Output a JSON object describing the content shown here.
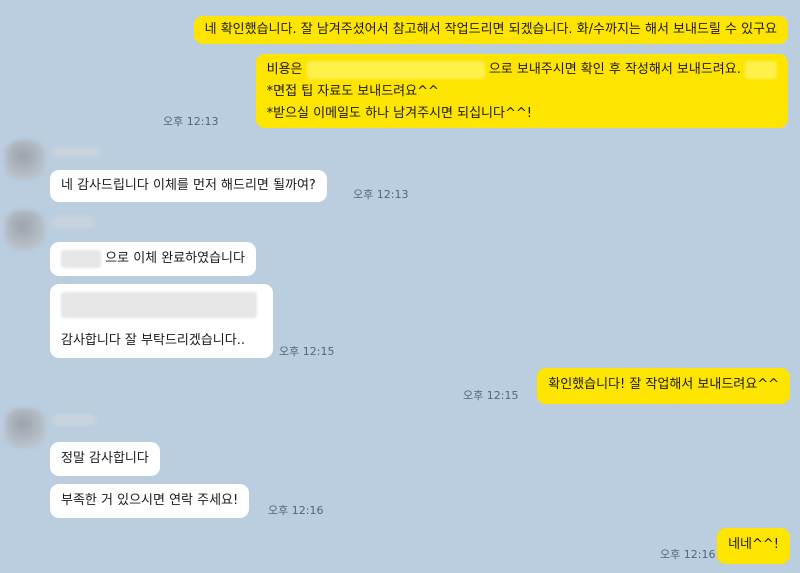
{
  "top_hint": "...",
  "messages": {
    "m1": {
      "text": "네 확인했습니다. 잘 남겨주셨어서 참고해서 작업드리면 되겠습니다. 화/수까지는 해서 보내드릴 수 있구요"
    },
    "m2": {
      "line1_prefix": "비용은",
      "line1_suffix": "으로 보내주시면 확인 후 작성해서 보내드려요.",
      "line2": "*면접 팁 자료도 보내드려요^^",
      "line3": "*받으실 이메일도 하나 남겨주시면 되십니다^^!",
      "time": "오후 12:13"
    },
    "m3": {
      "text": "네 감사드립니다 이체를 먼저 해드리면 될까여?",
      "time": "오후 12:13"
    },
    "m4": {
      "text": "으로 이체 완료하였습니다"
    },
    "m5": {
      "text": "감사합니다 잘 부탁드리겠습니다..",
      "time": "오후 12:15"
    },
    "m6": {
      "text": "확인했습니다! 잘 작업해서 보내드려요^^",
      "time": "오후 12:15"
    },
    "m7": {
      "text": "정말 감사합니다"
    },
    "m8": {
      "text": "부족한 거 있으시면 연락 주세요!",
      "time": "오후 12:16"
    },
    "m9": {
      "text": "네네^^!",
      "time": "오후 12:16"
    }
  },
  "colors": {
    "background": "#bacee0",
    "my_bubble": "#fee500",
    "their_bubble": "#ffffff"
  },
  "icons": {
    "avatar": "blurred-profile-avatar"
  }
}
